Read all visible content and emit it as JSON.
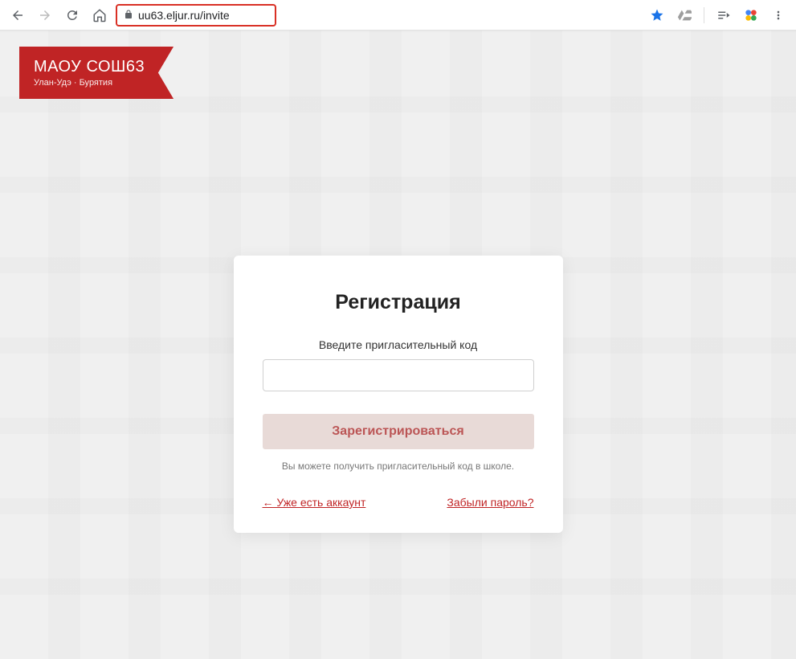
{
  "browser": {
    "url": "uu63.eljur.ru/invite"
  },
  "school": {
    "name": "МАОУ СОШ63",
    "location": "Улан-Удэ · Бурятия"
  },
  "card": {
    "title": "Регистрация",
    "input_label": "Введите пригласительный код",
    "input_value": "",
    "register_button": "Зарегистрироваться",
    "hint": "Вы можете получить пригласительный код в школе.",
    "link_existing": "← Уже есть аккаунт",
    "link_forgot": "Забыли пароль?"
  }
}
